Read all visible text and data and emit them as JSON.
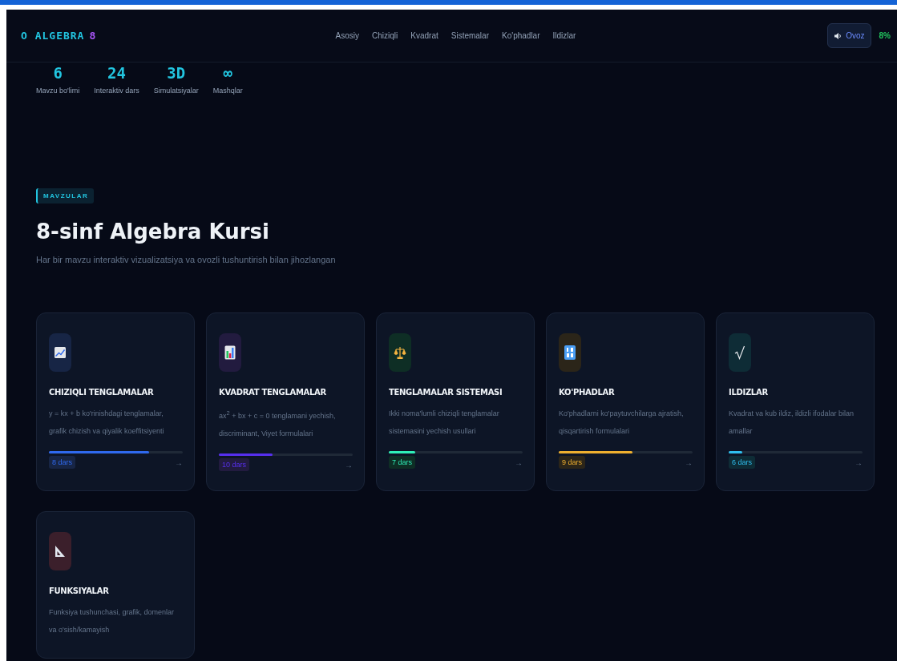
{
  "nav": {
    "logo_text": "O ALGEBRA",
    "logo_number": "8",
    "links": [
      "Asosiy",
      "Chiziqli",
      "Kvadrat",
      "Sistemalar",
      "Ko'phadlar",
      "Ildizlar"
    ],
    "sound_button": "Ovoz",
    "progress_text": "8%"
  },
  "stats": [
    {
      "value": "6",
      "label": "Mavzu bo'limi"
    },
    {
      "value": "24",
      "label": "Interaktiv dars"
    },
    {
      "value": "3D",
      "label": "Simulatsiyalar"
    },
    {
      "value": "∞",
      "label": "Mashqlar"
    }
  ],
  "section": {
    "tag": "MAVZULAR",
    "title": "8-sinf Algebra Kursi",
    "subtitle": "Har bir mavzu interaktiv vizualizatsiya va ovozli tushuntirish bilan jihozlangan"
  },
  "cards": [
    {
      "color": "#172545",
      "title": "CHIZIQLI TENGLAMALAR",
      "description": "y = kx + b ko'rinishdagi tenglamalar, grafik chizish va qiyalik koeffitsiyenti",
      "level": 0.75,
      "lessons": "8 dars",
      "arrow": "→"
    },
    {
      "color": "#221b3f",
      "title": "KVADRAT TENGLAMALAR",
      "description": "ax$^{2}$ + bx + c = 0 tenglamani yechish, discriminant, Viyet formulalari",
      "level": 0.4,
      "lessons": "10 dars",
      "arrow": "→"
    },
    {
      "color": "#0e2e25",
      "title": "TENGLAMALAR SISTEMASI",
      "description": "Ikki noma'lumli chiziqli tenglamalar sistemasini yechish usullari",
      "level": 0.2,
      "lessons": "7 dars",
      "arrow": "→"
    },
    {
      "color": "#2b2519",
      "title": "KO'PHADLAR",
      "description": "Ko'phadlarni ko'paytuvchilarga ajratish, qisqartirish formulalari",
      "level": 0.55,
      "lessons": "9 dars",
      "arrow": "→"
    },
    {
      "color": "#0e2c36",
      "title": "ILDIZLAR",
      "description": "Kvadrat va kub ildiz, ildizli ifodalar bilan amallar",
      "level": 0.1,
      "lessons": "6 dars",
      "arrow": "→"
    },
    {
      "color": "#3b1f2b",
      "title": "FUNKSIYALAR",
      "description": "Funksiya tushunchasi, grafik, domenlar va o'sish/kamayish"
    }
  ]
}
